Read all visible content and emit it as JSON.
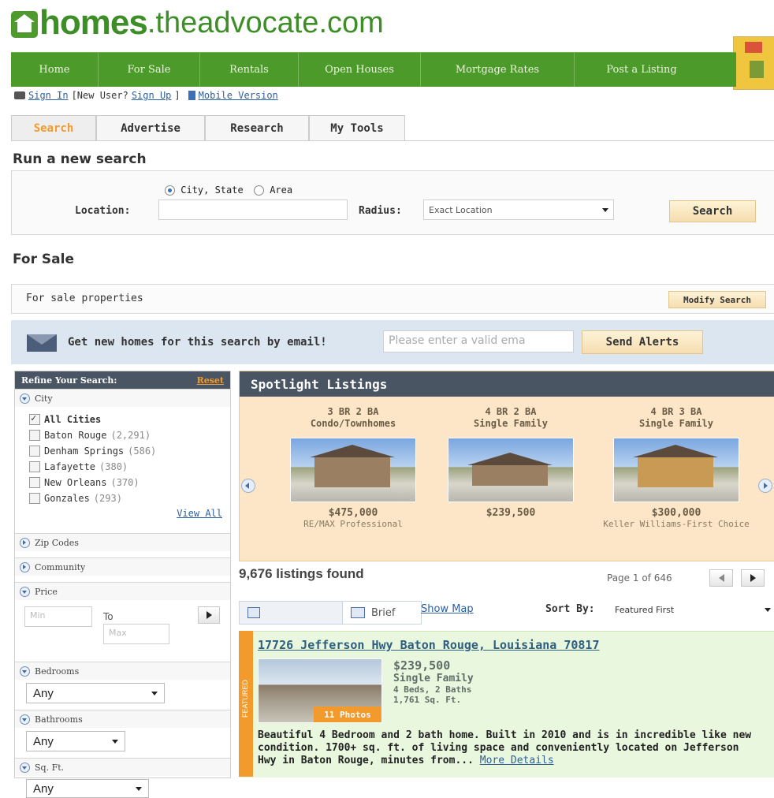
{
  "brand": {
    "main": "homes",
    "sub": ".theadvocate.com"
  },
  "nav": [
    "Home",
    "For Sale",
    "Rentals",
    "Open Houses",
    "Mortgage Rates",
    "Post a Listing"
  ],
  "userbar": {
    "sign_in": "Sign In",
    "new_user": "[New User?",
    "sign_up": "Sign Up",
    "close": "]",
    "mobile": "Mobile Version"
  },
  "tabs": [
    "Search",
    "Advertise",
    "Research",
    "My Tools"
  ],
  "new_search": {
    "heading": "Run a new search",
    "opt_city": "City, State",
    "opt_area": "Area",
    "location_label": "Location:",
    "location_value": "",
    "radius_label": "Radius:",
    "radius_value": "Exact Location",
    "search_button": "Search"
  },
  "for_sale": {
    "heading": "For Sale",
    "subtitle": "For sale properties",
    "modify_button": "Modify Search"
  },
  "alerts": {
    "text": "Get new homes for this search by email!",
    "placeholder": "Please enter a valid ema",
    "button": "Send Alerts"
  },
  "refine": {
    "title": "Refine Your Search:",
    "reset": "Reset",
    "city_label": "City",
    "cities": [
      {
        "name": "All Cities",
        "count": "",
        "checked": true
      },
      {
        "name": "Baton Rouge",
        "count": "(2,291)",
        "checked": false
      },
      {
        "name": "Denham Springs",
        "count": "(586)",
        "checked": false
      },
      {
        "name": "Lafayette",
        "count": "(380)",
        "checked": false
      },
      {
        "name": "New Orleans",
        "count": "(370)",
        "checked": false
      },
      {
        "name": "Gonzales",
        "count": "(293)",
        "checked": false
      }
    ],
    "view_all": "View All",
    "zip": "Zip Codes",
    "community": "Community",
    "price": "Price",
    "min_placeholder": "Min",
    "to": "To",
    "max_placeholder": "Max",
    "bedrooms": "Bedrooms",
    "bedrooms_value": "Any",
    "bathrooms": "Bathrooms",
    "bathrooms_value": "Any",
    "sqft": "Sq. Ft.",
    "sqft_value": "Any"
  },
  "spotlight": {
    "title": "Spotlight Listings",
    "cards": [
      {
        "line1": "3 BR 2 BA",
        "line2": "Condo/Townhomes",
        "price": "$475,000",
        "agent": "RE/MAX Professional"
      },
      {
        "line1": "4 BR 2 BA",
        "line2": "Single Family",
        "price": "$239,500",
        "agent": ""
      },
      {
        "line1": "4 BR 3 BA",
        "line2": "Single Family",
        "price": "$300,000",
        "agent": "Keller Williams-First Choice"
      }
    ]
  },
  "results": {
    "count": "9,676 listings found",
    "page": "Page 1 of 646",
    "brief": "Brief",
    "show_map": "Show Map",
    "sort_label": "Sort By:",
    "sort_value": "Featured First"
  },
  "listing": {
    "address": "17726 Jefferson Hwy Baton Rouge, Louisiana 70817",
    "price": "$239,500",
    "type": "Single Family",
    "beds": "4 Beds, 2 Baths",
    "sqft": "1,761 Sq. Ft.",
    "photos": "11 Photos",
    "featured": "FEATURED",
    "description": "Beautiful 4 Bedroom and 2 bath home. Built in 2010 and is in incredible like new condition. 1700+ sq. ft. of living space and conveniently located on Jefferson Hwy in Baton Rouge, minutes from...",
    "more": "More Details"
  },
  "colors": {
    "brand_green": "#4c9a2a",
    "accent_orange": "#f39a2d",
    "panel_dark": "#4a5563"
  }
}
